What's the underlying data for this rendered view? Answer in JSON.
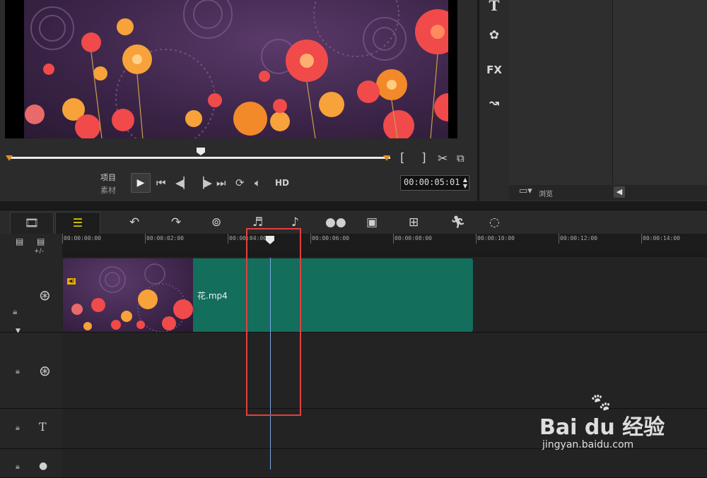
{
  "preview": {
    "mode_project": "项目",
    "mode_clip": "素材",
    "hd": "HD",
    "timecode": "00:00:05:01",
    "scrub_position_pct": 49,
    "trim_in": "[",
    "trim_out": "]"
  },
  "library": {
    "browse_label": "浏览",
    "side_tools": [
      "text-icon",
      "transition-icon",
      "FX",
      "path-icon"
    ],
    "fx_label": "FX"
  },
  "toolbar": {
    "icons": [
      "film-strip-icon",
      "timeline-view-icon",
      "undo-icon",
      "redo-icon",
      "record-capture-icon",
      "audio-mixer-icon",
      "auto-music-icon",
      "motion-track-icon",
      "subtitle-icon",
      "multi-camera-icon",
      "mask-icon",
      "path-icon"
    ]
  },
  "ruler": {
    "ticks": [
      "00:00:00:00",
      "00:00:02:00",
      "00:00:04:00",
      "00:00:06:00",
      "00:00:08:00",
      "00:00:10:00",
      "00:00:12:00",
      "00:00:14:00"
    ],
    "zoom_label": "+/-"
  },
  "clip": {
    "name": "花.mp4"
  },
  "watermark": {
    "brand": "Bai du 经验",
    "url": "jingyan.baidu.com"
  },
  "colors": {
    "clip": "#136e5c",
    "playhead": "#7aa8e8",
    "highlight": "#e04040",
    "timeline_view_active": "#e8e000"
  }
}
